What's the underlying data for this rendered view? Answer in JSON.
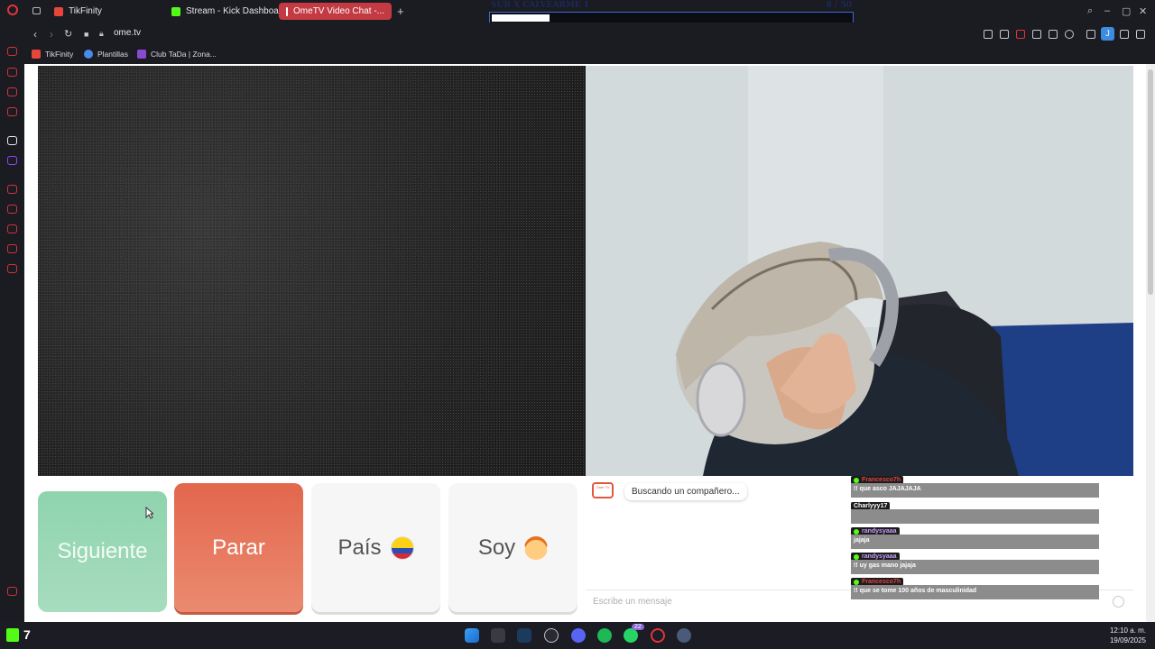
{
  "tabs": [
    {
      "title": "TikFinity",
      "color": "#e8463c"
    },
    {
      "title": "Stream - Kick Dashboard",
      "color": "#53fc18"
    },
    {
      "title": "OmeTV Video Chat -...",
      "color": "#ffffff",
      "active": true
    }
  ],
  "overlay": {
    "goal_title": "SUB X CALVEARME 1",
    "goal_count": "8 / 50",
    "goal_progress": 0.16
  },
  "address": {
    "url": "ome.tv"
  },
  "bookmarks": [
    {
      "label": "TikFinity"
    },
    {
      "label": "Plantillas"
    },
    {
      "label": "Club TaDa | Zona..."
    }
  ],
  "controls": {
    "next_label": "Siguiente",
    "stop_label": "Parar",
    "country_label": "País",
    "iam_label": "Soy"
  },
  "chat": {
    "logo_text": "Ome TV",
    "status": "Buscando un compañero...",
    "placeholder": "Escribe un mensaje"
  },
  "kick_chat": [
    {
      "user": "Francesco7h",
      "text": "!! que asco JAJAJAJA"
    },
    {
      "user": "Charlyyy17",
      "text": ""
    },
    {
      "user": "randysyaaa",
      "text": "jajaja"
    },
    {
      "user": "randysyaaa",
      "text": "!! uy gas mano jajaja"
    },
    {
      "user": "Francesco7h",
      "text": "!! que se tome 100 años de masculinidad"
    }
  ],
  "taskbar": {
    "kick_count": "7",
    "whatsapp_badge": "22",
    "time": "12:10 a. m.",
    "date": "19/09/2025"
  }
}
